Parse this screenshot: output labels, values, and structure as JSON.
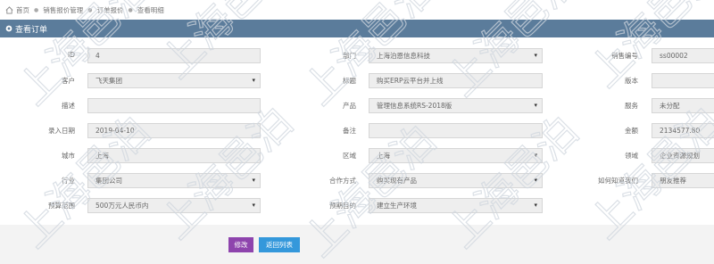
{
  "breadcrumb": [
    "首页",
    "销售报价管理",
    "订单报价",
    "查看明细"
  ],
  "panel": {
    "title": "查看订单"
  },
  "form": {
    "rows": [
      [
        {
          "label": "ID",
          "value": "4",
          "select": false
        },
        {
          "label": "部门",
          "value": "上海泊恩信息科技",
          "select": true
        },
        {
          "label": "销售编号",
          "value": "ss00002",
          "select": false
        }
      ],
      [
        {
          "label": "客户",
          "value": "飞天集团",
          "select": true
        },
        {
          "label": "标题",
          "value": "购买ERP云平台并上线",
          "select": false
        },
        {
          "label": "版本",
          "value": "",
          "select": false
        }
      ],
      [
        {
          "label": "描述",
          "value": "",
          "select": false
        },
        {
          "label": "产品",
          "value": "管理信息系统RS-2018版",
          "select": true
        },
        {
          "label": "服务",
          "value": "未分配",
          "select": false
        }
      ],
      [
        {
          "label": "录入日期",
          "value": "2019-04-10",
          "select": false
        },
        {
          "label": "备注",
          "value": "",
          "select": false
        },
        {
          "label": "金额",
          "value": "2134577.80",
          "select": false
        }
      ],
      [
        {
          "label": "城市",
          "value": "上海",
          "select": false
        },
        {
          "label": "区域",
          "value": "上海",
          "select": true
        },
        {
          "label": "领域",
          "value": "企业资源规划",
          "select": false
        }
      ],
      [
        {
          "label": "行业",
          "value": "集团公司",
          "select": true
        },
        {
          "label": "合作方式",
          "value": "购买现有产品",
          "select": true
        },
        {
          "label": "如何知道我们",
          "value": "朋友推荐",
          "select": false
        }
      ],
      [
        {
          "label": "预算范围",
          "value": "500万元人民币内",
          "select": true
        },
        {
          "label": "预期目的",
          "value": "建立生产环境",
          "select": true
        },
        null
      ]
    ]
  },
  "buttons": {
    "edit": "修改",
    "back": "返回列表"
  },
  "watermark": "上海邑泊",
  "colors": {
    "header": "#5b7c9b",
    "edit": "#8e44ad",
    "back": "#3498db"
  }
}
